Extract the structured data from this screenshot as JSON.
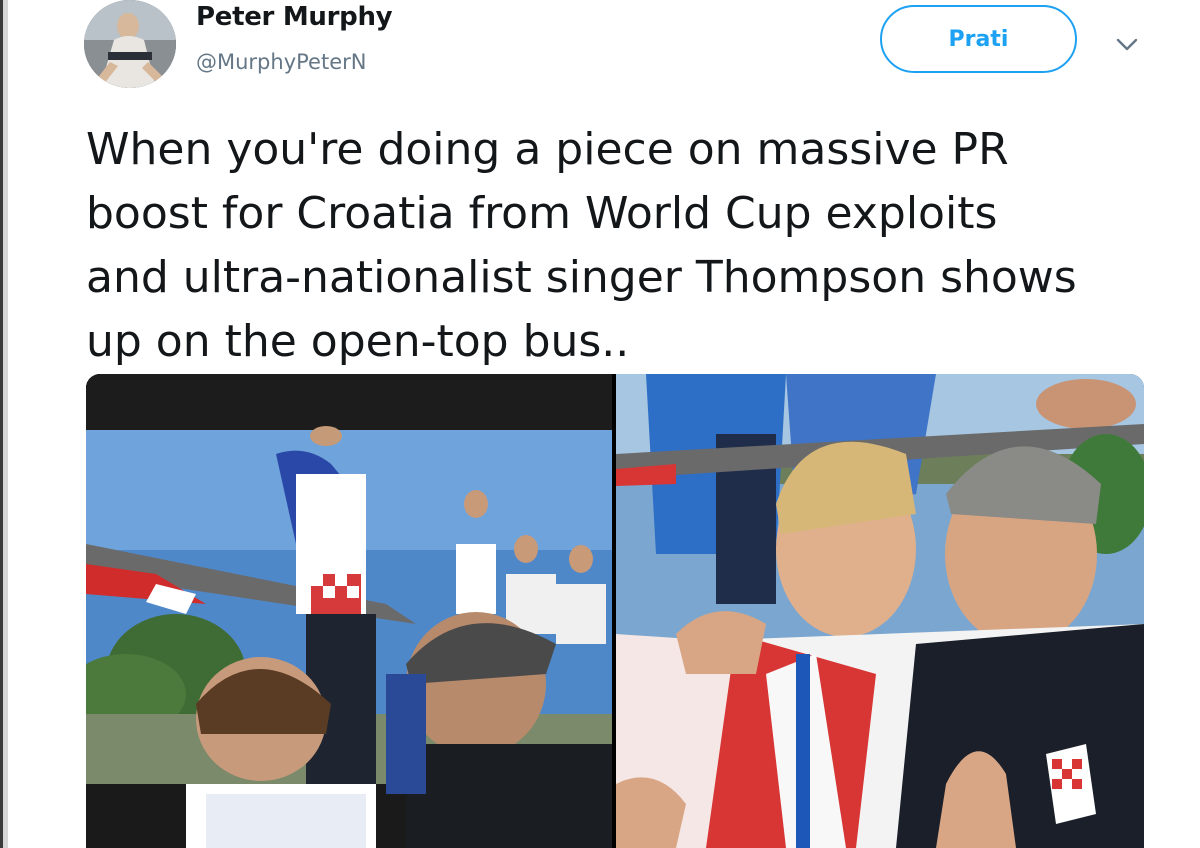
{
  "tweet": {
    "author": {
      "display_name": "Peter Murphy",
      "handle": "@MurphyPeterN",
      "avatar_icon": "user-avatar"
    },
    "follow_label": "Prati",
    "menu_icon": "chevron-down-icon",
    "text": "When you're doing a piece on massive PR\nboost for Croatia from World Cup exploits\nand ultra-nationalist singer Thompson shows\nup on the open-top bus..",
    "media": [
      {
        "kind": "photo",
        "description_icon": "photo-bus-parade"
      },
      {
        "kind": "photo",
        "description_icon": "photo-selfie"
      }
    ]
  },
  "colors": {
    "accent": "#1da1f2",
    "text": "#14171a",
    "secondary": "#657786"
  }
}
